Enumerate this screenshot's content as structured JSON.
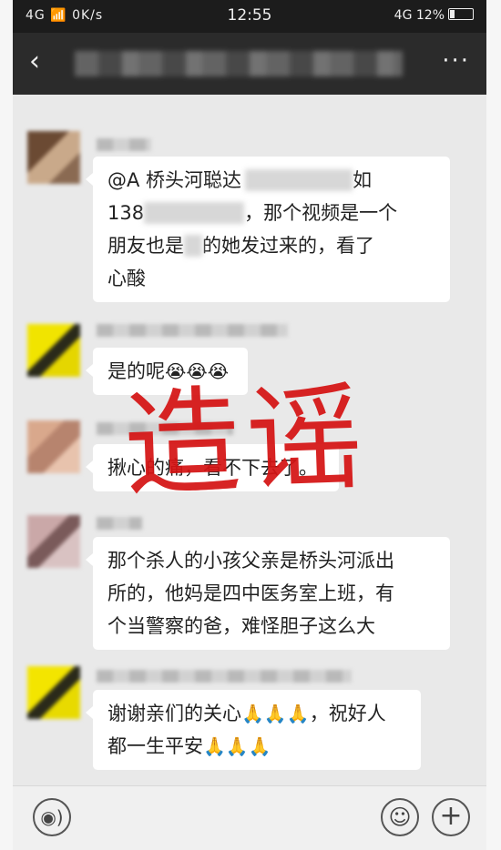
{
  "status_bar": {
    "left": "4G 📶  0K/s",
    "time": "12:55",
    "right": "4G 12%"
  },
  "title_bar": {
    "back_icon": "back-arrow-icon",
    "more_icon": "more-dots-icon",
    "more": "···"
  },
  "messages": [
    {
      "lines": [
        "@A 桥头河聪达",
        "138",
        "，那个视频是一个",
        "朋友也是",
        "的她发过来的，看了",
        "心酸"
      ]
    },
    {
      "text": "是的呢",
      "emoji": "😭😭😭"
    },
    {
      "text": "揪心的痛，看不下去了。"
    },
    {
      "lines": [
        "那个杀人的小孩父亲是桥头河派出",
        "所的，他妈是四中医务室上班，有",
        "个当警察的爸，难怪胆子这么大"
      ]
    },
    {
      "lines": [
        "谢谢亲们的关心",
        "🙏🙏🙏",
        "，祝好人",
        "都一生平安",
        "🙏🙏🙏"
      ]
    }
  ],
  "stamp": "造谣",
  "input_bar": {
    "voice_icon": "voice-icon",
    "emoji_icon": "emoji-icon",
    "plus_icon": "plus-icon",
    "plus": "+",
    "smile": "☺"
  }
}
